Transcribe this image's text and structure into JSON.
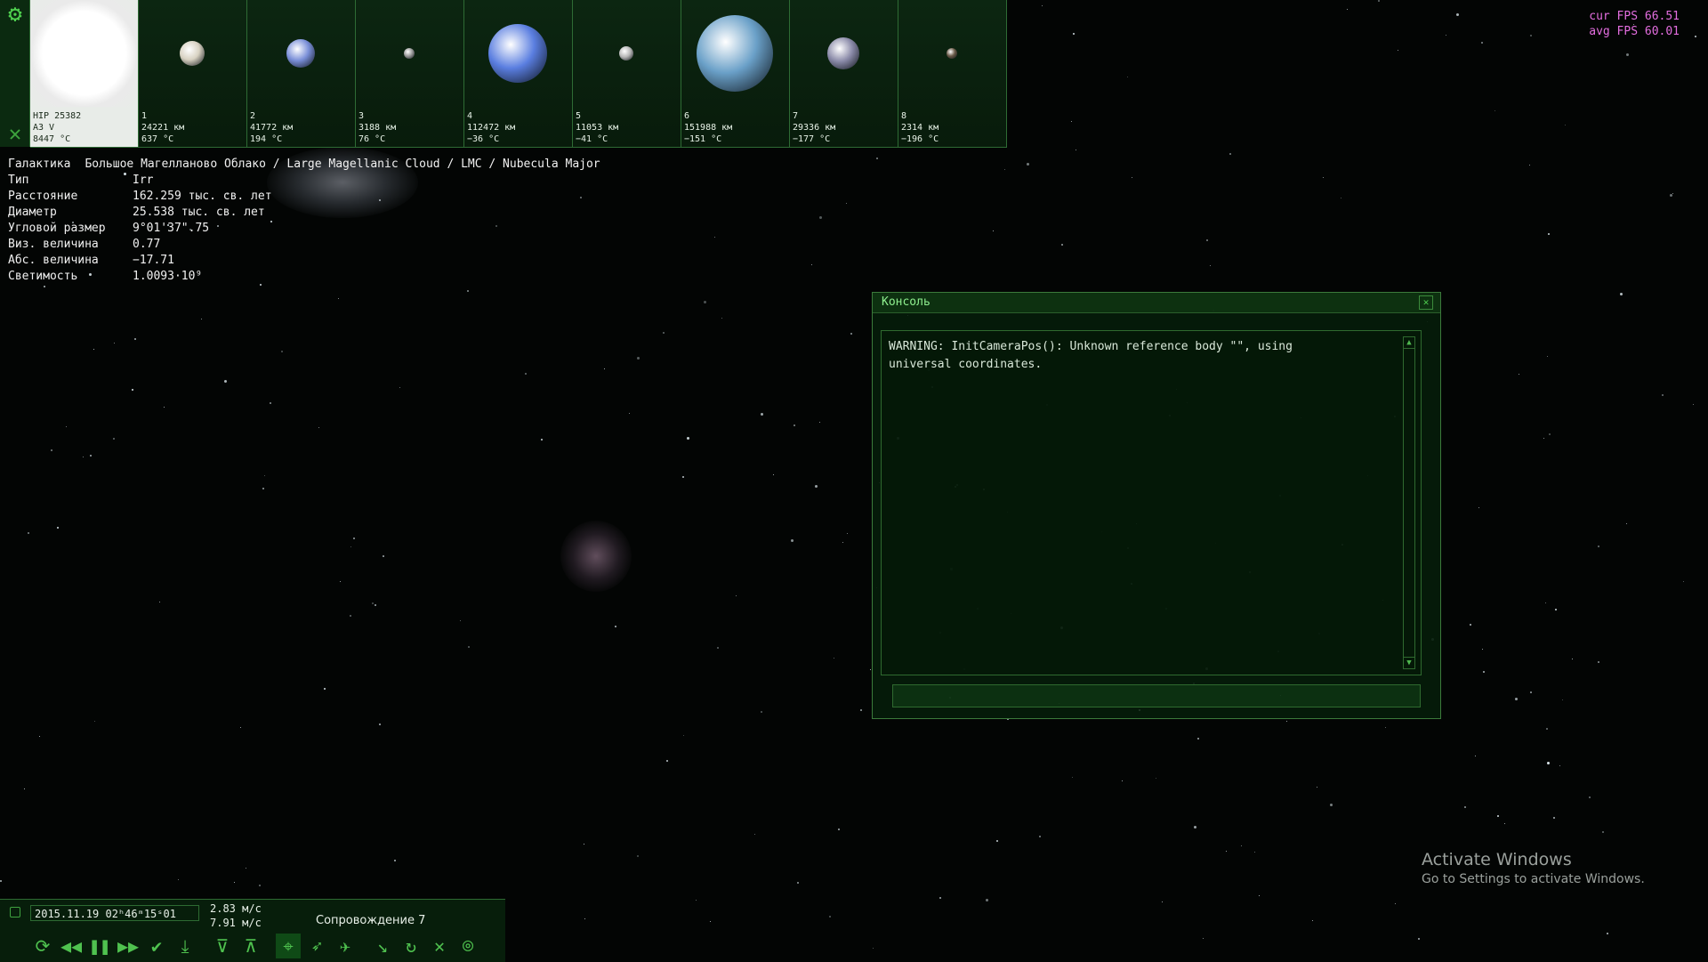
{
  "fps": {
    "cur": "cur FPS 66.51",
    "avg": "avg FPS 60.01"
  },
  "bodies": [
    {
      "line1": "HIP 25382",
      "line2": "A3 V",
      "line3": "8447 °C",
      "selected": true,
      "color": "#ffffff"
    },
    {
      "line1": "1",
      "line2": "24221 км",
      "line3": "637 °C",
      "color": "#d8d2c2"
    },
    {
      "line1": "2",
      "line2": "41772 км",
      "line3": "194 °C",
      "color": "#7a8fd8"
    },
    {
      "line1": "3",
      "line2": "3188 км",
      "line3": "76 °C",
      "color": "#9a9a9a"
    },
    {
      "line1": "4",
      "line2": "112472 км",
      "line3": "−36 °C",
      "color": "#5a7ee0"
    },
    {
      "line1": "5",
      "line2": "11053 км",
      "line3": "−41 °C",
      "color": "#b8b8b8"
    },
    {
      "line1": "6",
      "line2": "151988 км",
      "line3": "−151 °C",
      "color": "#6aa0c8"
    },
    {
      "line1": "7",
      "line2": "29336 км",
      "line3": "−177 °C",
      "color": "#8a8aa8"
    },
    {
      "line1": "8",
      "line2": "2314 км",
      "line3": "−196 °C",
      "color": "#6a5a48"
    }
  ],
  "info": {
    "header_key": "Галактика",
    "header_value": "Большое Магелланово Облако / Large Magellanic Cloud / LMC / Nubecula Major",
    "rows": [
      {
        "k": "Тип",
        "v": "Irr"
      },
      {
        "k": "Расстояние",
        "v": "162.259 тыс. св. лет"
      },
      {
        "k": "Диаметр",
        "v": "25.538 тыс. св. лет"
      },
      {
        "k": "Угловой размер",
        "v": "9°01'37\".75"
      },
      {
        "k": "Виз. величина",
        "v": "0.77"
      },
      {
        "k": "Абс. величина",
        "v": "−17.71"
      },
      {
        "k": "Светимость",
        "v": "1.0093·10⁹"
      }
    ]
  },
  "console": {
    "title": "Консоль",
    "log": "WARNING: InitCameraPos(): Unknown reference body \"\", using universal coordinates.",
    "input_value": ""
  },
  "watermark": {
    "line1": "Activate Windows",
    "line2": "Go to Settings to activate Windows."
  },
  "bottom": {
    "date": "2015.11.19  02ʰ46ᵐ15ˢ01",
    "speed1": "2.83 м/с",
    "speed2": "7.91 м/с",
    "follow": "Сопровождение 7"
  }
}
